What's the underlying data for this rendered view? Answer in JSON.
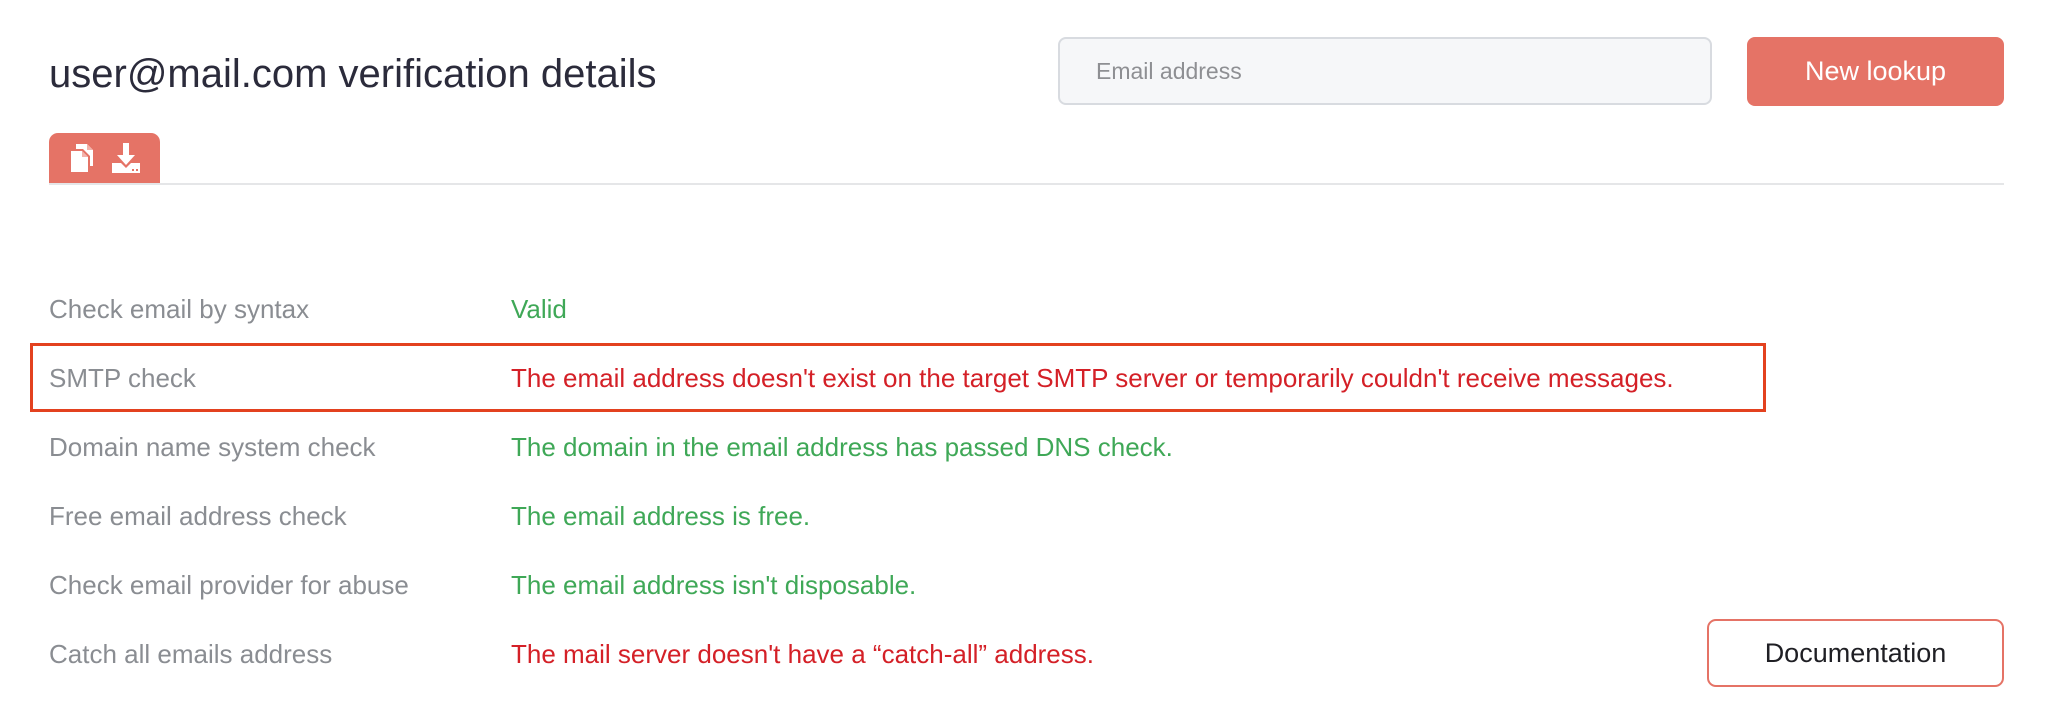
{
  "header": {
    "title": "user@mail.com verification details",
    "search_placeholder": "Email address",
    "search_value": "",
    "lookup_label": "New lookup"
  },
  "toolbar": {
    "icons": [
      "copy-icon",
      "download-icon"
    ],
    "accent": "#e57366"
  },
  "results": [
    {
      "label": "Check email by syntax",
      "value": "Valid",
      "status": "ok"
    },
    {
      "label": "SMTP check",
      "value": "The email address doesn't exist on the target SMTP server or temporarily couldn't receive messages.",
      "status": "fail"
    },
    {
      "label": "Domain name system check",
      "value": "The domain in the email address has passed DNS check.",
      "status": "ok"
    },
    {
      "label": "Free email address check",
      "value": "The email address is free.",
      "status": "ok"
    },
    {
      "label": "Check email provider for abuse",
      "value": "The email address isn't disposable.",
      "status": "ok"
    },
    {
      "label": "Catch all emails address",
      "value": "The mail server doesn't have a “catch-all” address.",
      "status": "fail"
    }
  ],
  "colors": {
    "ok": "#3fa857",
    "fail": "#d42027",
    "highlight": "#e3411f"
  },
  "footer": {
    "documentation_label": "Documentation"
  }
}
